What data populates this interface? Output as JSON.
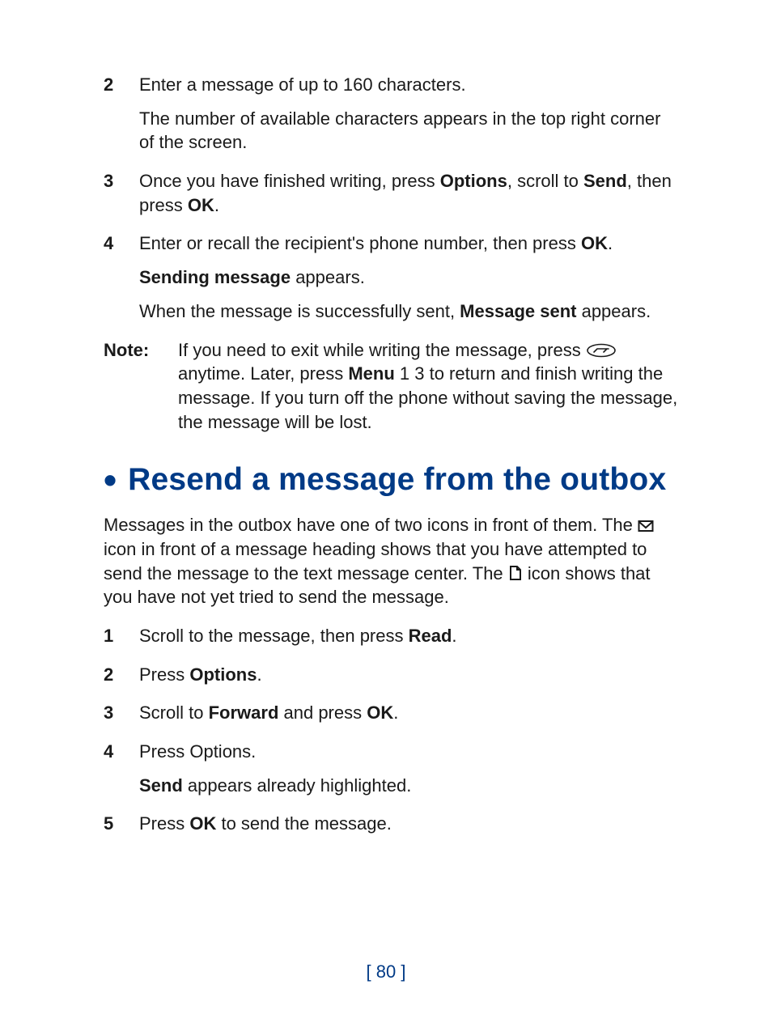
{
  "ol_top": [
    {
      "num": "2",
      "paras": [
        [
          {
            "t": "Enter a message of up to 160 characters."
          }
        ],
        [
          {
            "t": "The number of available characters appears in the top right corner of the screen."
          }
        ]
      ]
    },
    {
      "num": "3",
      "paras": [
        [
          {
            "t": "Once you have finished writing, press "
          },
          {
            "t": "Options",
            "b": true
          },
          {
            "t": ", scroll to "
          },
          {
            "t": "Send",
            "b": true
          },
          {
            "t": ", then press "
          },
          {
            "t": "OK",
            "b": true
          },
          {
            "t": "."
          }
        ]
      ]
    },
    {
      "num": "4",
      "paras": [
        [
          {
            "t": "Enter or recall the recipient's phone number, then press "
          },
          {
            "t": "OK",
            "b": true
          },
          {
            "t": "."
          }
        ],
        [
          {
            "t": "Sending message",
            "b": true
          },
          {
            "t": " appears."
          }
        ],
        [
          {
            "t": "When the message is successfully sent, "
          },
          {
            "t": "Message sent",
            "b": true
          },
          {
            "t": " appears."
          }
        ]
      ]
    }
  ],
  "note": {
    "label": "Note:",
    "body": [
      {
        "t": "If you need to exit while writing the message, press "
      },
      {
        "icon": "end-key"
      },
      {
        "t": " anytime. Later, press "
      },
      {
        "t": "Menu",
        "b": true
      },
      {
        "t": " 1 3 to return and finish writing the message. If you turn off the phone without saving the message, the message will be lost."
      }
    ]
  },
  "heading": "Resend a message from the outbox",
  "intro": [
    {
      "t": "Messages in the outbox have one of two icons in front of them. The "
    },
    {
      "icon": "envelope"
    },
    {
      "t": " icon in front of a message heading shows that you have attempted to send the message to the text message center. The "
    },
    {
      "icon": "document"
    },
    {
      "t": " icon shows that you have not yet tried to send the message."
    }
  ],
  "ol_bottom": [
    {
      "num": "1",
      "paras": [
        [
          {
            "t": "Scroll to the message, then press "
          },
          {
            "t": "Read",
            "b": true
          },
          {
            "t": "."
          }
        ]
      ]
    },
    {
      "num": "2",
      "paras": [
        [
          {
            "t": "Press "
          },
          {
            "t": "Options",
            "b": true
          },
          {
            "t": "."
          }
        ]
      ]
    },
    {
      "num": "3",
      "paras": [
        [
          {
            "t": "Scroll to "
          },
          {
            "t": "Forward",
            "b": true
          },
          {
            "t": " and press "
          },
          {
            "t": "OK",
            "b": true
          },
          {
            "t": "."
          }
        ]
      ]
    },
    {
      "num": "4",
      "paras": [
        [
          {
            "t": "Press Options."
          }
        ],
        [
          {
            "t": "Send",
            "b": true
          },
          {
            "t": " appears already highlighted."
          }
        ]
      ]
    },
    {
      "num": "5",
      "paras": [
        [
          {
            "t": "Press "
          },
          {
            "t": "OK",
            "b": true
          },
          {
            "t": " to send the message."
          }
        ]
      ]
    }
  ],
  "page_number": "[ 80 ]"
}
